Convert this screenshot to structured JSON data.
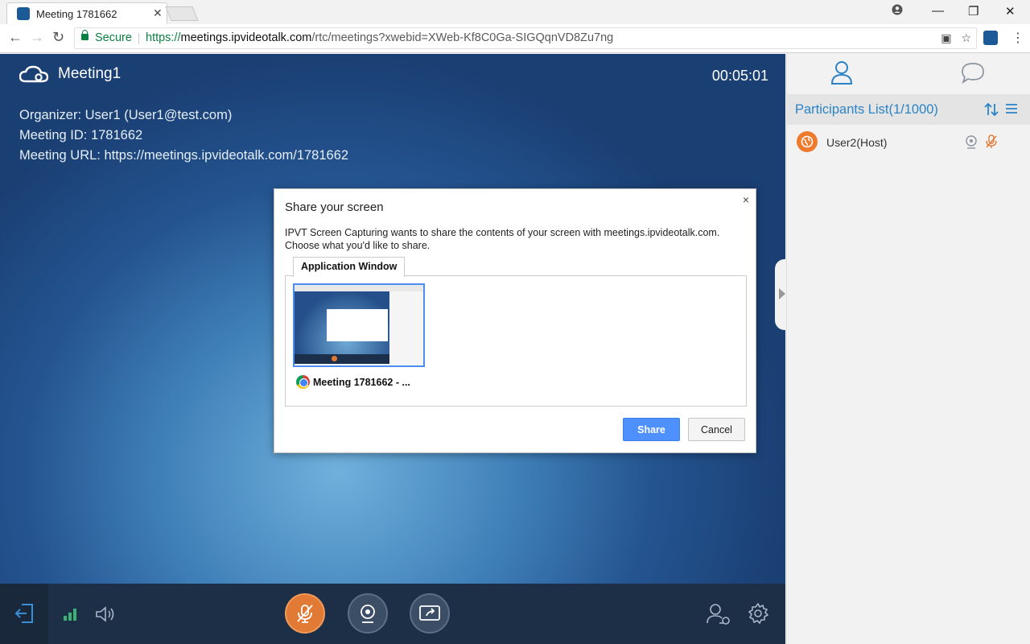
{
  "browser": {
    "tab_title": "Meeting 1781662",
    "secure_label": "Secure",
    "url_scheme": "https://",
    "url_host": "meetings.ipvideotalk.com",
    "url_path": "/rtc/meetings?xwebid=XWeb-Kf8C0Ga-SIGQqnVD8Zu7ng"
  },
  "meeting": {
    "title": "Meeting1",
    "timer": "00:05:01",
    "organizer": "Organizer: User1 (User1@test.com)",
    "meeting_id": "Meeting ID: 1781662",
    "meeting_url": "Meeting URL: https://meetings.ipvideotalk.com/1781662"
  },
  "dialog": {
    "title": "Share your screen",
    "close": "×",
    "description_line1": "IPVT Screen Capturing wants to share the contents of your screen with meetings.ipvideotalk.com.",
    "description_line2": "Choose what you'd like to share.",
    "tab_label": "Application Window",
    "source_name": "Meeting 1781662 - ...",
    "share_label": "Share",
    "cancel_label": "Cancel"
  },
  "participants": {
    "header": "Participants List(1/1000)",
    "items": [
      {
        "name": "User2(Host)"
      }
    ]
  },
  "colors": {
    "accent_blue": "#2b83c7",
    "mic_orange": "#e07a35",
    "share_button": "#4d90fe",
    "signal_green": "#3bb273"
  }
}
